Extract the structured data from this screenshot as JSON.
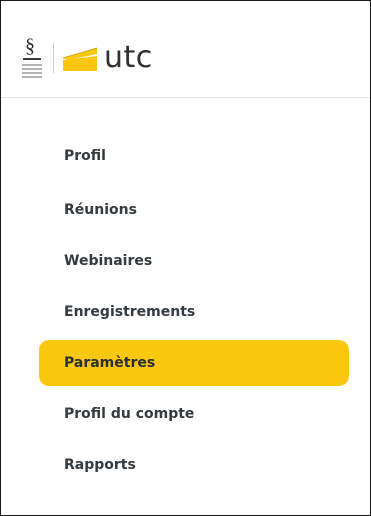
{
  "header": {
    "logo_text": "utc",
    "sorbonne_mark": "§",
    "accent_color": "#f9c80e"
  },
  "sidebar": {
    "items": [
      {
        "label": "Profil",
        "active": false
      },
      {
        "label": "Réunions",
        "active": false
      },
      {
        "label": "Webinaires",
        "active": false
      },
      {
        "label": "Enregistrements",
        "active": false
      },
      {
        "label": "Paramètres",
        "active": true
      },
      {
        "label": "Profil du compte",
        "active": false
      },
      {
        "label": "Rapports",
        "active": false
      }
    ]
  }
}
